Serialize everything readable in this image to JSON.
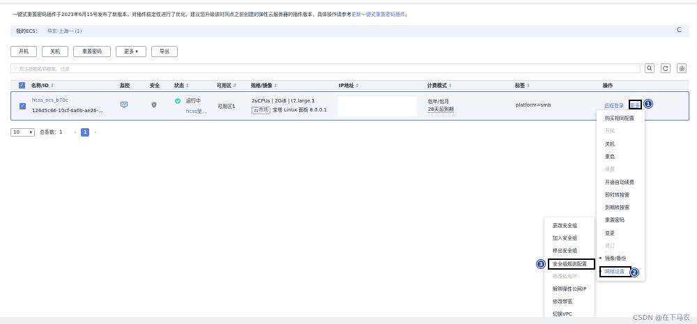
{
  "notice": {
    "text": "一键式重置密码插件于2023年6月15号发布了新版本，对插件稳定性进行了优化，建议您升级该时间点之前创建的弹性云服务器的插件版本，具体操作请参考",
    "link": "更新一键式重置密码插件",
    "end": "。"
  },
  "ecs": {
    "label": "我的ECS：",
    "region": "华东-上海一 (1)",
    "refresh_icon": "C"
  },
  "toolbar": {
    "buttons": [
      "开机",
      "关机",
      "重置密码",
      "更多 ▾",
      "导出"
    ]
  },
  "search": {
    "placeholder": "默认按照名称搜索、过滤"
  },
  "table": {
    "headers": [
      "名称/ID",
      "监控",
      "安全",
      "状态",
      "可用区",
      "规格/镜像",
      "IP地址",
      "计费模式",
      "标签",
      "操作"
    ],
    "row": {
      "name": "hcss_ecs_b70c",
      "id": "126d5c66-10cf-4a0b-ae26-...",
      "status": "运行中",
      "status_sub": "hcss使...",
      "az": "可用区1",
      "spec": "2vCPUs | 2GiB | t7.large.1",
      "image_tag": "云市场",
      "image": "宝塔 Linux 面板 8.0.0.1",
      "billing": "包年/包月",
      "billing_sub": "28天后到期",
      "tag": "platform=smb",
      "op_login": "远程登录",
      "op_more": "更多"
    }
  },
  "pager": {
    "size": "10",
    "total": "总条数：1",
    "page": "1"
  },
  "menu_main": [
    "购买相同配置",
    "开机",
    "关机",
    "重启",
    "续费",
    "开通自动续费",
    "即时转按需",
    "到期转按需",
    "重置密码",
    "变更",
    "退订",
    "镜像/备份",
    "网络设置"
  ],
  "menu_main_disabled": [
    1,
    4,
    10
  ],
  "menu_net": [
    "更改安全组",
    "加入安全组",
    "移出安全组",
    "安全组规则配置",
    "修改私有IP",
    "解绑弹性公网IP",
    "修改带宽",
    "切换VPC"
  ],
  "menu_net_disabled": [
    4
  ],
  "badges": [
    "1",
    "2",
    "3"
  ],
  "watermark": "CSDN @在下马农"
}
